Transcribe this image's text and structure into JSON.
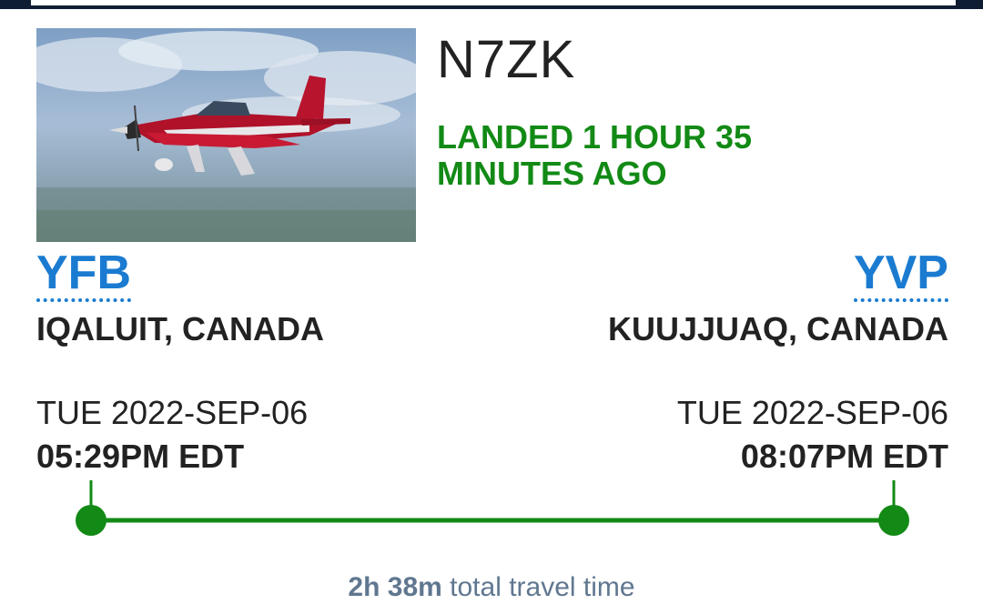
{
  "flight": {
    "tail_number": "N7ZK",
    "status": "LANDED 1 HOUR 35 MINUTES AGO",
    "status_color": "#128a15"
  },
  "origin": {
    "code": "YFB",
    "city": "IQALUIT, CANADA",
    "date": "TUE 2022-SEP-06",
    "time": "05:29PM EDT"
  },
  "destination": {
    "code": "YVP",
    "city": "KUUJJUAQ, CANADA",
    "date": "TUE 2022-SEP-06",
    "time": "08:07PM EDT"
  },
  "progress": {
    "fraction_complete": 1.0,
    "color": "#128a15"
  },
  "travel": {
    "duration": "2h 38m",
    "label": "total travel time"
  },
  "photo": {
    "icon": "aircraft-photo"
  }
}
